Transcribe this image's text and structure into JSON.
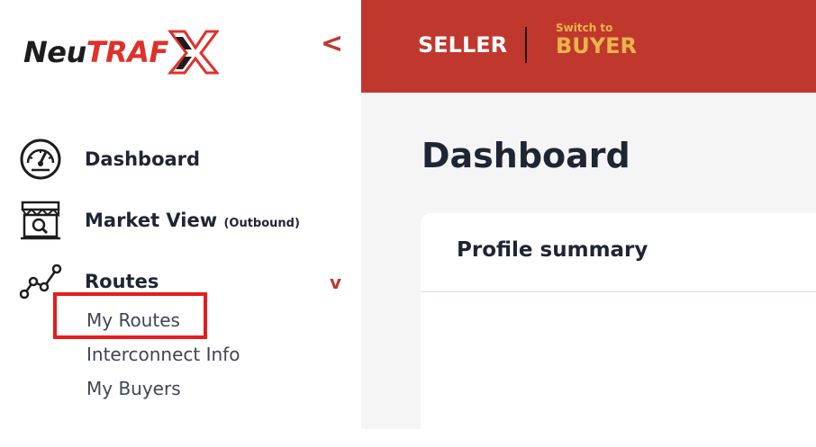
{
  "logo": {
    "part1": "Neu",
    "part2": "TRAF",
    "mark": "X"
  },
  "sidebar": {
    "collapse_icon": "<",
    "items": [
      {
        "label": "Dashboard",
        "icon": "speedometer-icon",
        "sub": ""
      },
      {
        "label": "Market View",
        "icon": "market-store-icon",
        "sub": "(Outbound)"
      },
      {
        "label": "Routes",
        "icon": "routes-graph-icon",
        "sub": "",
        "expand": "v"
      }
    ],
    "routes_submenu": [
      {
        "label": "My Routes"
      },
      {
        "label": "Interconnect Info"
      },
      {
        "label": "My Buyers"
      }
    ]
  },
  "topbar": {
    "seller_label": "SELLER",
    "switch_small": "Switch to",
    "switch_big": "BUYER"
  },
  "main": {
    "title": "Dashboard",
    "card_title": "Profile summary"
  },
  "colors": {
    "brand_red": "#c0372e",
    "accent_gold": "#e8b54a",
    "highlight": "#e81b1b"
  }
}
